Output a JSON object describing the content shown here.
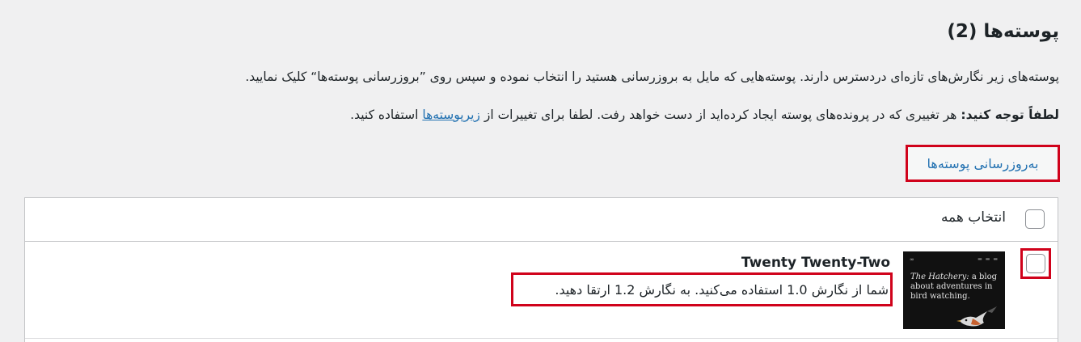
{
  "heading": "پوسته‌ها (2)",
  "intro": "پوسته‌های زیر نگارش‌های تازه‌ای دردسترس دارند. پوسته‌هایی که مایل به بروزرسانی هستید را انتخاب نموده و سپس روی ”بروزرسانی پوسته‌ها“ کلیک نمایید.",
  "notice": {
    "label": "لطفاً توجه کنید:",
    "text": " هر تغییری که در پرونده‌های پوسته ایجاد کرده‌اید از دست خواهد رفت. لطفا برای تغییرات از ",
    "link": "زیرپوسته‌ها",
    "suffix": " استفاده کنید."
  },
  "update_button": "به‌روزرسانی پوسته‌ها",
  "table": {
    "select_all_label": "انتخاب همه",
    "themes": [
      {
        "name": "Twenty Twenty-Two",
        "note": "شما از نگارش 1.0 استفاده می‌کنید. به نگارش 1.2 ارتقا دهید.",
        "thumbnail": {
          "logo": "∞",
          "title_italic": "The Hatchery:",
          "tagline": " a blog about adventures in bird watching."
        }
      }
    ]
  },
  "colors": {
    "background": "#f0f0f1",
    "link": "#2271b1",
    "highlight": "#d0021b"
  }
}
